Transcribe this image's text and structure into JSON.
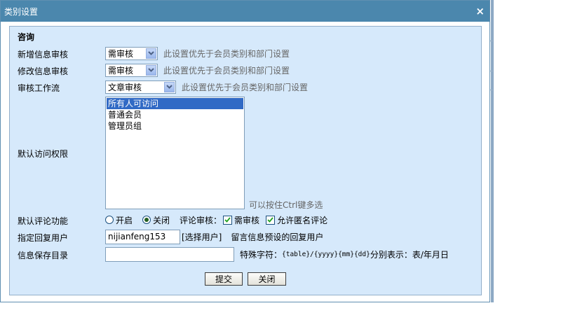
{
  "dialog": {
    "title": "类别设置",
    "close_glyph": "×"
  },
  "section": {
    "title": "咨询"
  },
  "fields": {
    "new_review": {
      "label": "新增信息审核",
      "value": "需审核",
      "hint": "此设置优先于会员类别和部门设置"
    },
    "edit_review": {
      "label": "修改信息审核",
      "value": "需审核",
      "hint": "此设置优先于会员类别和部门设置"
    },
    "workflow": {
      "label": "审核工作流",
      "value": "文章审核",
      "hint": "此设置优先于会员类别和部门设置"
    },
    "access": {
      "label": "默认访问权限",
      "options": [
        "所有人可访问",
        "普通会员",
        "管理员组"
      ],
      "selected": "所有人可访问",
      "hint": "可以按住Ctrl键多选"
    },
    "comment": {
      "label": "默认评论功能",
      "on_label": "开启",
      "off_label": "关闭",
      "selected": "关闭",
      "review_label": "评论审核：",
      "need_review_label": "需审核",
      "need_review_checked": true,
      "anonymous_label": "允许匿名评论",
      "anonymous_checked": true
    },
    "reply_user": {
      "label": "指定回复用户",
      "value": "nijianfeng153",
      "select_link": "[选择用户]",
      "hint": "留言信息预设的回复用户"
    },
    "save_dir": {
      "label": "信息保存目录",
      "value": "",
      "hint_prefix": "特殊字符：",
      "hint_code": "{table}/{yyyy}{mm}{dd}",
      "hint_suffix": "分别表示：表/年月日"
    }
  },
  "buttons": {
    "submit": "提交",
    "close": "关闭"
  },
  "icons": {
    "select_arrow": "chevron-down-icon",
    "check": "check-icon"
  },
  "colors": {
    "titlebar": "#4b87ad",
    "panel": "#d6e9fb",
    "selection": "#316ac5"
  }
}
